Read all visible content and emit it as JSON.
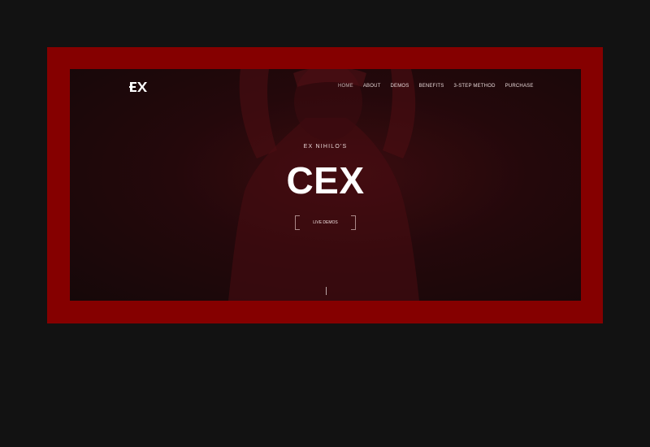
{
  "nav": {
    "items": [
      "HOME",
      "ABOUT",
      "DEMOS",
      "BENEFITS",
      "3-STEP METHOD",
      "PURCHASE"
    ],
    "active_index": 0
  },
  "hero": {
    "subtitle": "EX NIHILO'S",
    "title": "CEX",
    "cta_label": "LIVE DEMOS"
  },
  "logo": {
    "text": "EX"
  },
  "colors": {
    "page_background": "#121212",
    "frame": "#850000",
    "hero_overlay": "#24080b",
    "text": "#ffffff"
  }
}
